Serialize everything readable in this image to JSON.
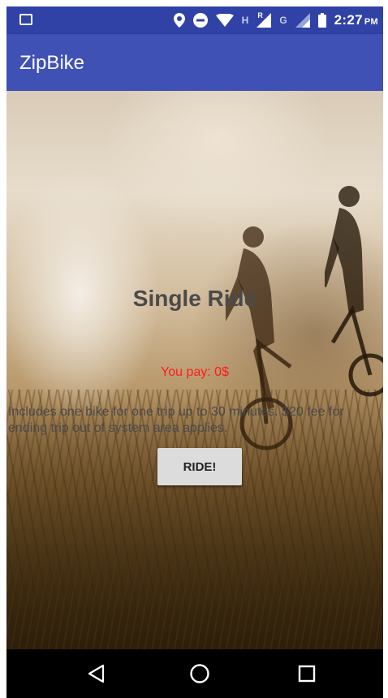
{
  "status_bar": {
    "time": "2:27",
    "ampm": "PM",
    "network_letter_1": "H",
    "network_letter_2": "R",
    "network_letter_3": "G"
  },
  "app_bar": {
    "title": "ZipBike"
  },
  "ride": {
    "title": "Single Ride",
    "price": "You pay: 0$",
    "description": "Includes one bike for one trip up to 30 minutes. $20 fee for ending trip out of system area applies.",
    "button_label": "RIDE!"
  },
  "colors": {
    "status_bar": "#3042a6",
    "app_bar": "#3f51b5",
    "price_text": "#ff1a1a",
    "button_bg": "#dcdcdc"
  },
  "icons": {
    "status_left": "image-notification-icon",
    "status_right": [
      "location-icon",
      "do-not-disturb-icon",
      "wifi-icon",
      "signal-icon",
      "signal-icon",
      "battery-icon"
    ],
    "nav": [
      "back-icon",
      "home-icon",
      "recents-icon"
    ]
  }
}
